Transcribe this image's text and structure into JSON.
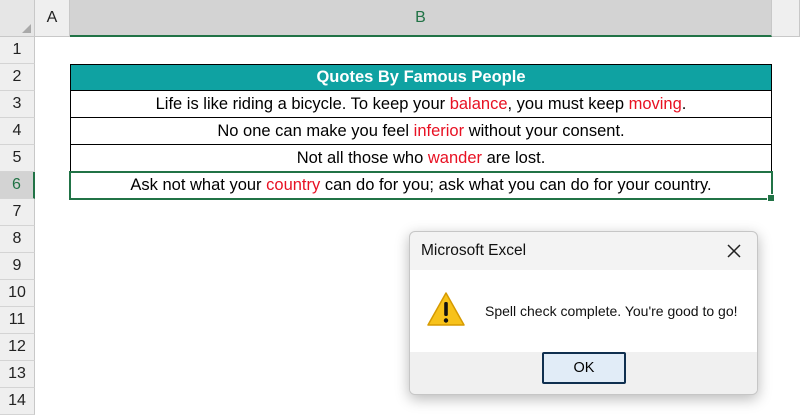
{
  "columns": [
    "A",
    "B"
  ],
  "rows": [
    "1",
    "2",
    "3",
    "4",
    "5",
    "6",
    "7",
    "8",
    "9",
    "10",
    "11",
    "12",
    "13",
    "14"
  ],
  "table": {
    "header": "Quotes By Famous People",
    "quotes": [
      {
        "segments": [
          {
            "text": "Life is like riding a bicycle. To keep your ",
            "misspelled": false
          },
          {
            "text": "balance",
            "misspelled": true
          },
          {
            "text": ", you must keep ",
            "misspelled": false
          },
          {
            "text": "moving",
            "misspelled": true
          },
          {
            "text": ".",
            "misspelled": false
          }
        ]
      },
      {
        "segments": [
          {
            "text": "No one can make you feel ",
            "misspelled": false
          },
          {
            "text": "inferior",
            "misspelled": true
          },
          {
            "text": " without your consent.",
            "misspelled": false
          }
        ]
      },
      {
        "segments": [
          {
            "text": "Not all those who ",
            "misspelled": false
          },
          {
            "text": "wander",
            "misspelled": true
          },
          {
            "text": " are lost.",
            "misspelled": false
          }
        ]
      },
      {
        "segments": [
          {
            "text": "Ask not what your ",
            "misspelled": false
          },
          {
            "text": "country",
            "misspelled": true
          },
          {
            "text": " can do for you; ask what you can do for your country.",
            "misspelled": false
          }
        ]
      }
    ]
  },
  "dialog": {
    "title": "Microsoft Excel",
    "message": "Spell check complete. You're good to go!",
    "ok_label": "OK",
    "icon": "warning-icon",
    "close_icon": "close-icon"
  },
  "colors": {
    "header_fill": "#0fa2a2",
    "highlight_text": "#e81123",
    "selection_accent": "#217346",
    "ok_button_fill": "#e1ecf7"
  }
}
